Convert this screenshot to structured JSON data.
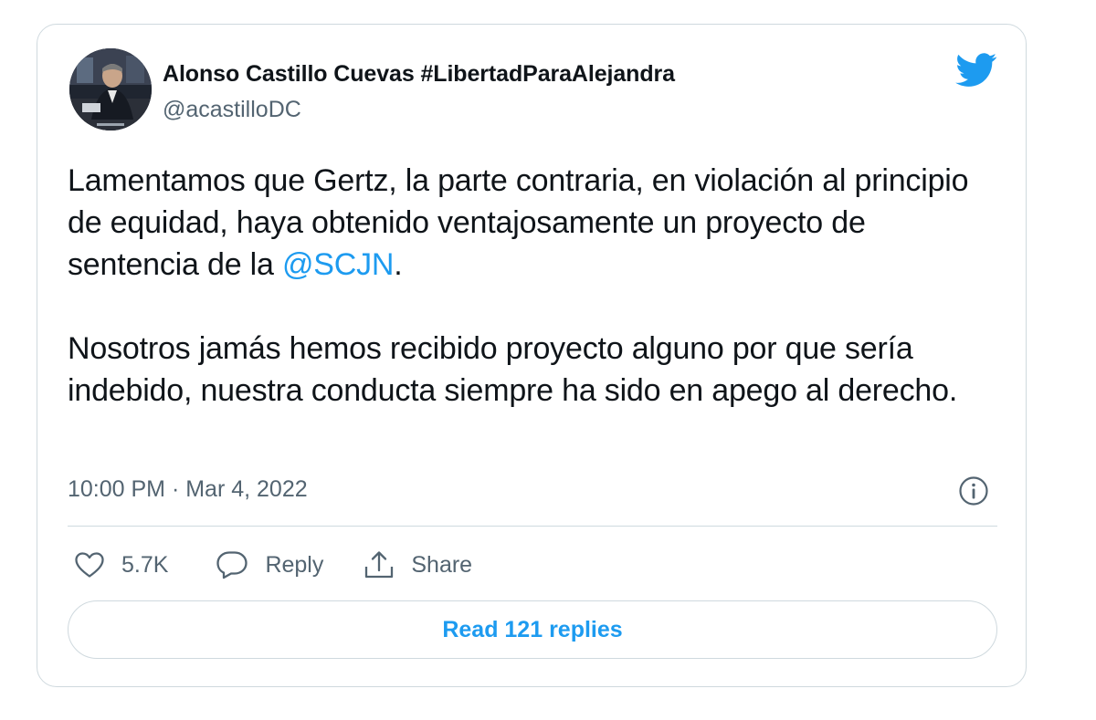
{
  "tweet": {
    "author_name": "Alonso Castillo Cuevas #LibertadParaAlejandra",
    "author_handle": "@acastilloDC",
    "text_part1_before_mention": "Lamentamos que Gertz, la parte contraria, en violación al principio de equidad, haya obtenido ventajosamente un proyecto de sentencia de la ",
    "mention": "@SCJN",
    "text_part1_after_mention": ".",
    "text_part2": "Nosotros jamás hemos recibido proyecto alguno por que sería indebido, nuestra conducta siempre ha sido en apego al derecho.",
    "timestamp": "10:00 PM · Mar 4, 2022"
  },
  "actions": {
    "like_count": "5.7K",
    "reply_label": "Reply",
    "share_label": "Share"
  },
  "read_replies_label": "Read 121 replies",
  "icons": {
    "brand": "twitter-bird-icon",
    "info": "info-icon",
    "like": "heart-icon",
    "reply": "speech-bubble-icon",
    "share": "share-icon"
  },
  "colors": {
    "accent": "#1d9bf0",
    "text": "#0f1419",
    "secondary_text": "#536471",
    "border": "#cfd9de"
  }
}
